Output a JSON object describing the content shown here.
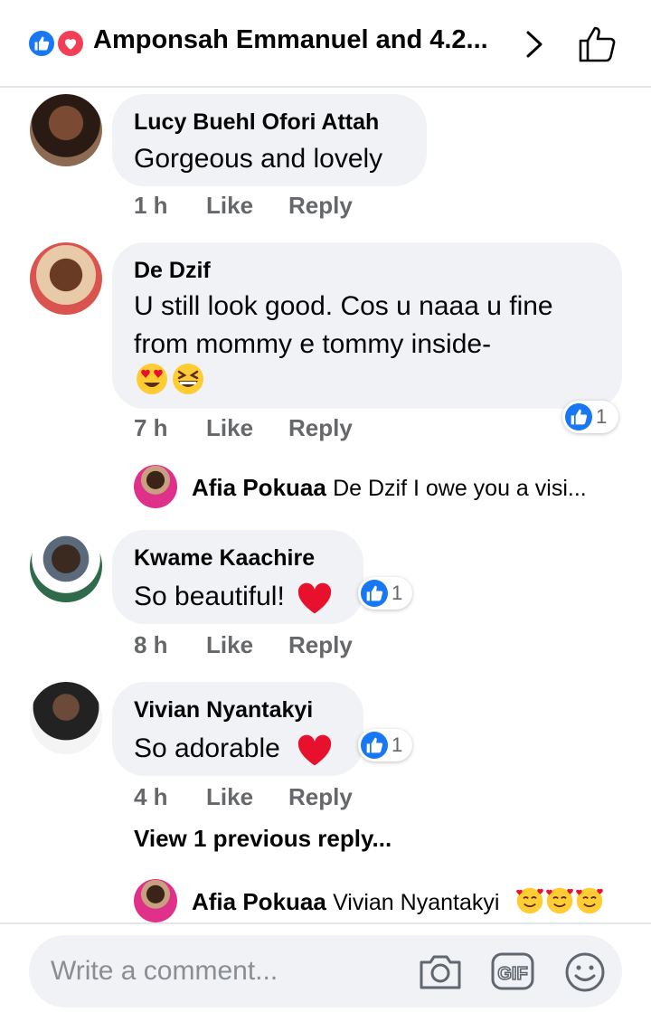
{
  "header": {
    "title": "Amponsah Emmanuel and 4.2..."
  },
  "comments": [
    {
      "name": "Lucy Buehl Ofori Attah",
      "lines": [
        "Gorgeous and lovely"
      ],
      "time": "1 h",
      "like": "Like",
      "reply": "Reply"
    },
    {
      "name": "De Dzif",
      "lines": [
        "U still look good. Cos u naaa u fine",
        "from mommy e tommy inside-"
      ],
      "time": "7 h",
      "like": "Like",
      "reply": "Reply",
      "reactions": "1"
    },
    {
      "name": "Kwame Kaachire",
      "lines": [
        "So beautiful!"
      ],
      "time": "8 h",
      "like": "Like",
      "reply": "Reply",
      "reactions": "1"
    },
    {
      "name": "Vivian Nyantakyi",
      "lines": [
        "So adorable"
      ],
      "time": "4 h",
      "like": "Like",
      "reply": "Reply",
      "reactions": "1"
    }
  ],
  "replies": [
    {
      "name": "Afia Pokuaa",
      "text": "De Dzif I owe you a visi..."
    },
    {
      "name": "Afia Pokuaa",
      "text": "Vivian Nyantakyi"
    }
  ],
  "view_previous": "View 1 previous reply...",
  "composer": {
    "placeholder": "Write a comment..."
  },
  "colors": {
    "like_blue": "#1877f2",
    "love_red": "#f33e58",
    "bubble_bg": "#f0f2f5",
    "meta_gray": "#65676b"
  },
  "icons": [
    "like-reaction-icon",
    "love-reaction-icon",
    "chevron-right-icon",
    "thumbs-up-outline-icon",
    "heart-eyes-emoji",
    "grinning-squint-emoji",
    "red-heart-emoji",
    "smiling-hearts-emoji",
    "camera-icon",
    "gif-icon",
    "smiley-icon"
  ]
}
